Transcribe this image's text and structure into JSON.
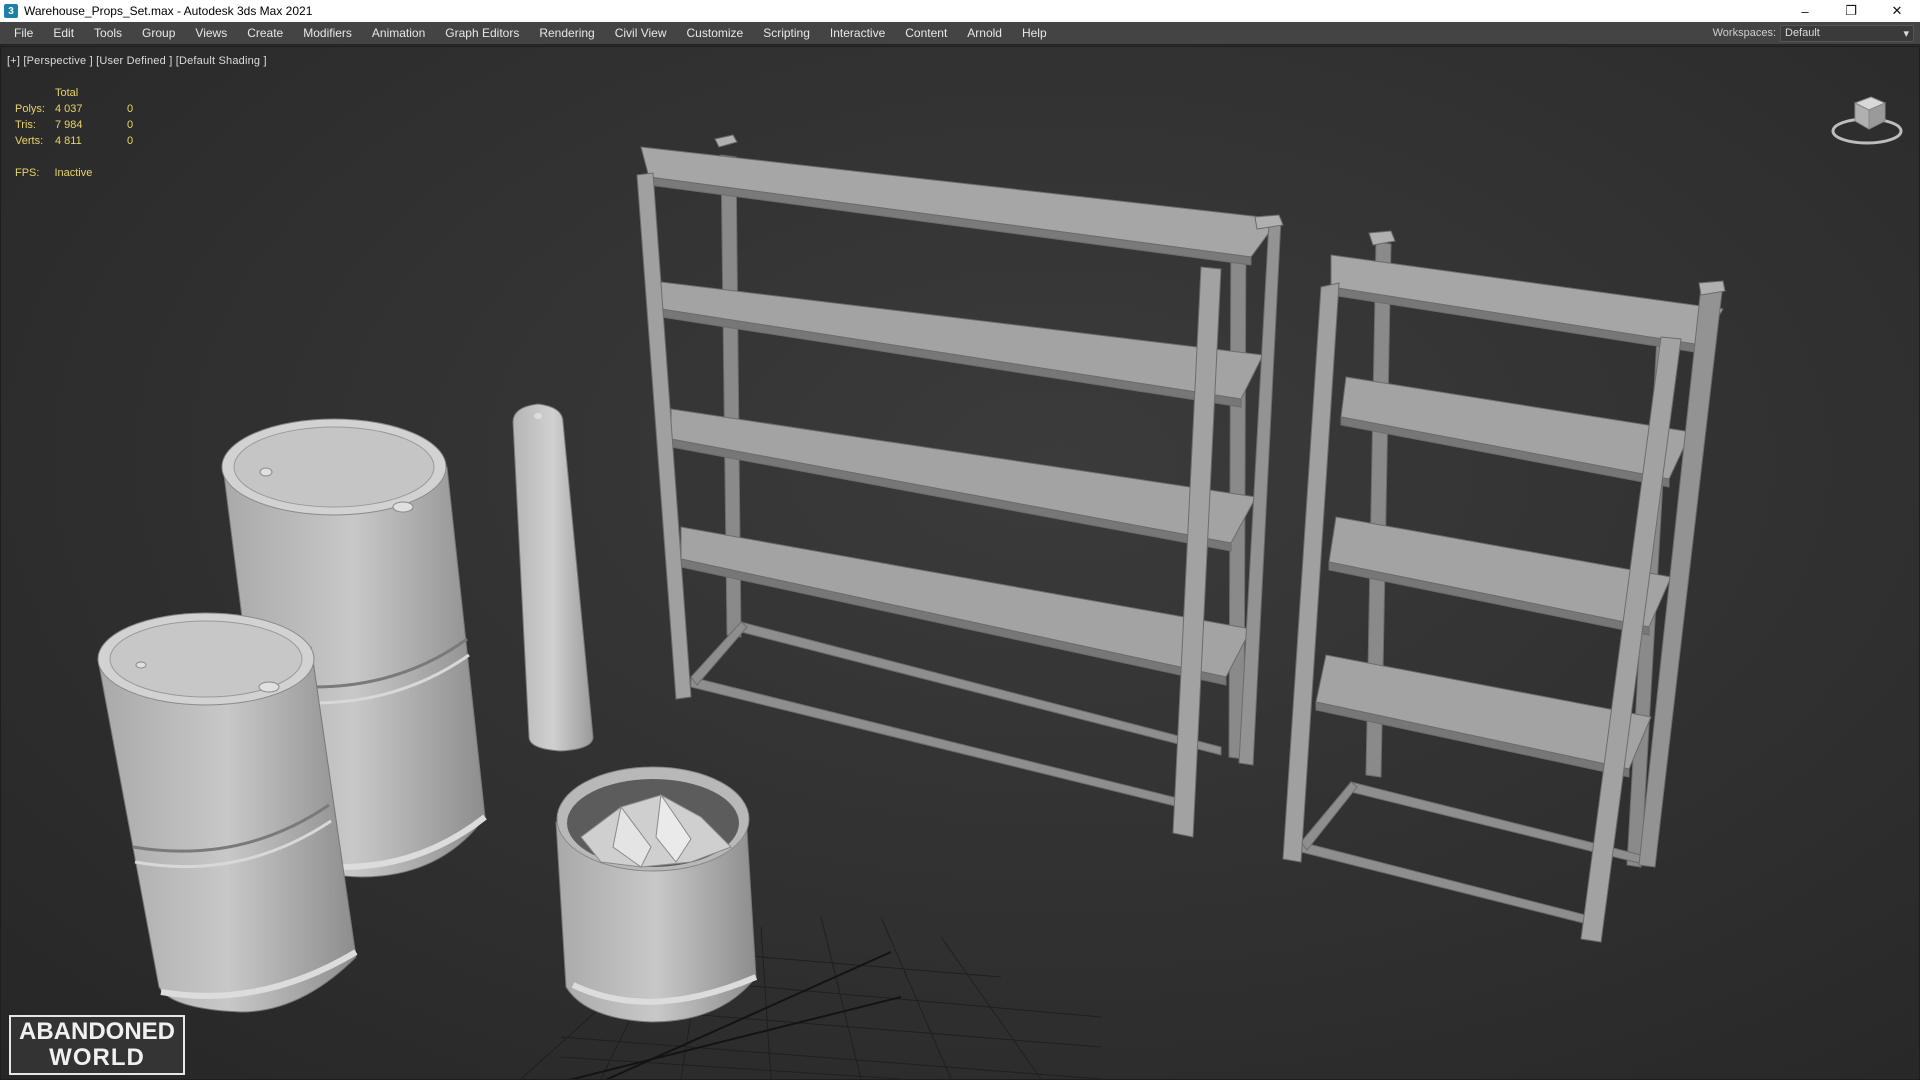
{
  "window": {
    "title": "Warehouse_Props_Set.max - Autodesk 3ds Max 2021",
    "app_icon": "3ds-max-icon",
    "controls": [
      "minimize-icon",
      "restore-icon",
      "close-icon"
    ]
  },
  "menu": {
    "items": [
      "File",
      "Edit",
      "Tools",
      "Group",
      "Views",
      "Create",
      "Modifiers",
      "Animation",
      "Graph Editors",
      "Rendering",
      "Civil View",
      "Customize",
      "Scripting",
      "Interactive",
      "Content",
      "Arnold",
      "Help"
    ],
    "workspace_label": "Workspaces:",
    "workspace_value": "Default"
  },
  "viewport": {
    "label": "[+] [Perspective ] [User Defined ] [Default Shading ]",
    "stats": {
      "header": "Total",
      "rows": [
        {
          "label": "Polys:",
          "total": "4 037",
          "sel": "0"
        },
        {
          "label": "Tris:",
          "total": "7 984",
          "sel": "0"
        },
        {
          "label": "Verts:",
          "total": "4 811",
          "sel": "0"
        }
      ]
    },
    "fps_label": "FPS:",
    "fps_value": "Inactive",
    "colors": {
      "stats": "#e8d46a",
      "geometry": "#9a9a9a",
      "background": "#333333"
    }
  },
  "logo": {
    "line1": "ABANDONED",
    "line2": "WORLD"
  }
}
